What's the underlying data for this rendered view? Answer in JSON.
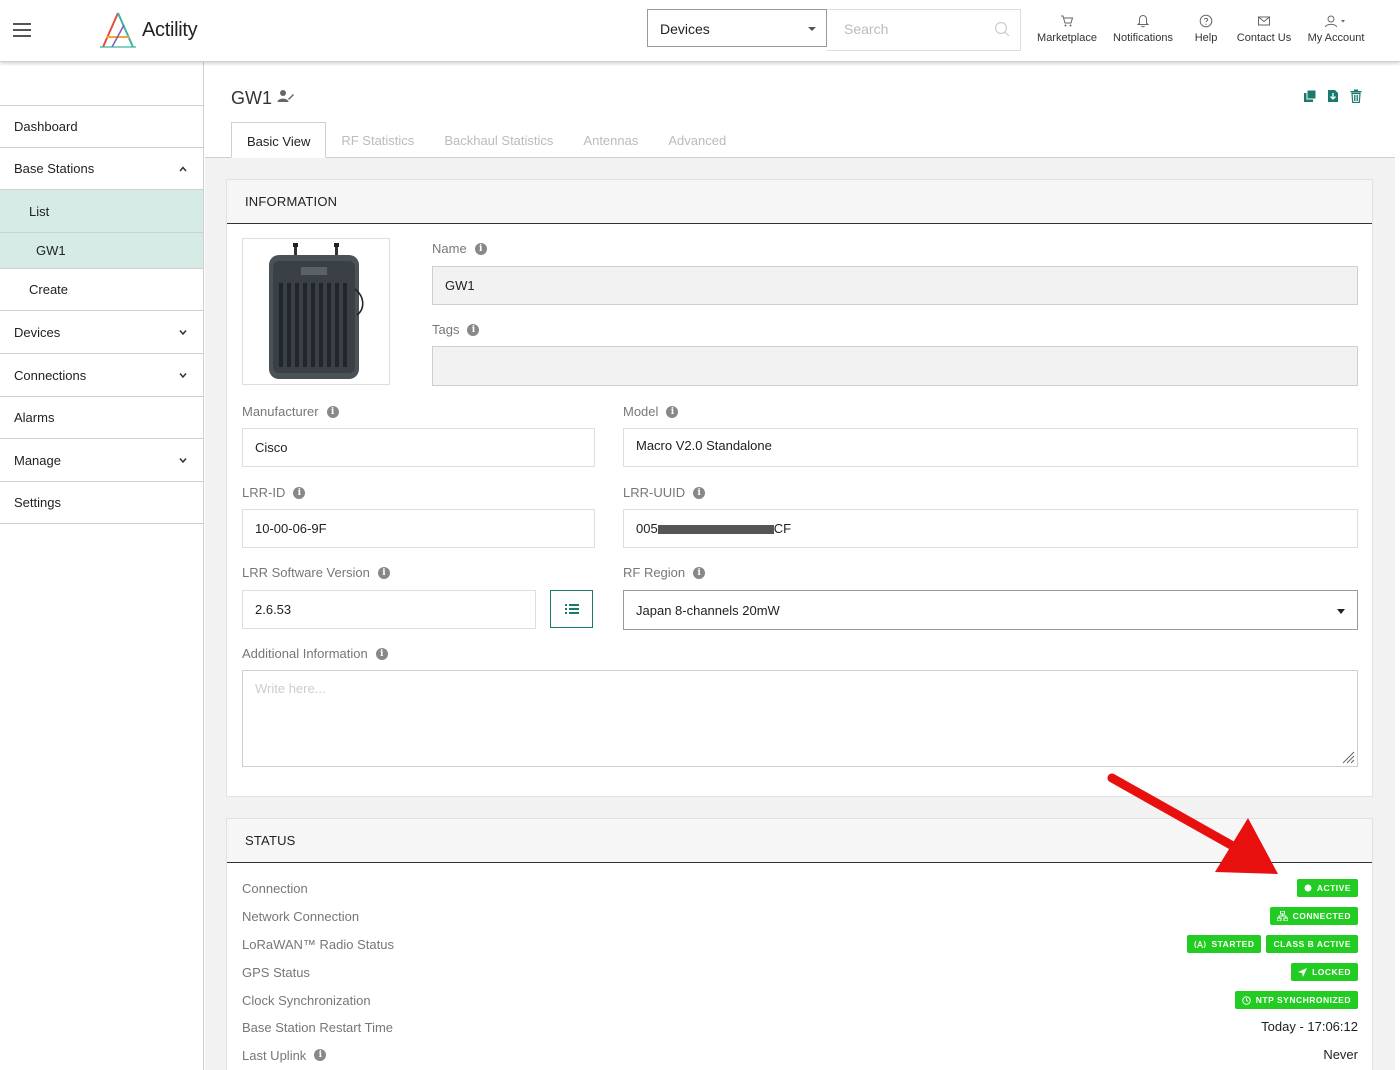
{
  "header": {
    "logo_text": "Actility",
    "entity_selector": "Devices",
    "search_placeholder": "Search",
    "nav": [
      {
        "label": "Marketplace",
        "icon": "cart-icon"
      },
      {
        "label": "Notifications",
        "icon": "bell-icon"
      },
      {
        "label": "Help",
        "icon": "help-icon"
      },
      {
        "label": "Contact Us",
        "icon": "mail-icon"
      },
      {
        "label": "My Account",
        "icon": "user-icon"
      }
    ]
  },
  "sidebar": {
    "items": [
      {
        "label": "Dashboard"
      },
      {
        "label": "Base Stations"
      },
      {
        "label": "List"
      },
      {
        "label": "GW1"
      },
      {
        "label": "Create"
      },
      {
        "label": "Devices"
      },
      {
        "label": "Connections"
      },
      {
        "label": "Alarms"
      },
      {
        "label": "Manage"
      },
      {
        "label": "Settings"
      }
    ]
  },
  "page": {
    "title": "GW1",
    "tabs": [
      "Basic View",
      "RF Statistics",
      "Backhaul Statistics",
      "Antennas",
      "Advanced"
    ]
  },
  "information": {
    "heading": "INFORMATION",
    "name_label": "Name",
    "name_value": "GW1",
    "tags_label": "Tags",
    "tags_value": "",
    "manufacturer_label": "Manufacturer",
    "manufacturer_value": "Cisco",
    "model_label": "Model",
    "model_value": "Macro V2.0 Standalone",
    "lrr_id_label": "LRR-ID",
    "lrr_id_value": "10-00-06-9F",
    "lrr_uuid_label": "LRR-UUID",
    "lrr_uuid_prefix": "005",
    "lrr_uuid_suffix": "CF",
    "software_label": "LRR Software Version",
    "software_value": "2.6.53",
    "rf_region_label": "RF Region",
    "rf_region_value": "Japan 8-channels 20mW",
    "additional_label": "Additional Information",
    "additional_placeholder": "Write here..."
  },
  "status": {
    "heading": "STATUS",
    "connection_label": "Connection",
    "connection_badge": "ACTIVE",
    "network_label": "Network Connection",
    "network_badge": "CONNECTED",
    "radio_label": "LoRaWAN™ Radio Status",
    "radio_badge_1": "STARTED",
    "radio_badge_2": "CLASS B ACTIVE",
    "gps_label": "GPS Status",
    "gps_badge": "LOCKED",
    "clock_label": "Clock Synchronization",
    "clock_badge": "NTP SYNCHRONIZED",
    "restart_label": "Base Station Restart Time",
    "restart_value": "Today - 17:06:12",
    "uplink_label": "Last Uplink",
    "uplink_value": "Never"
  },
  "colors": {
    "accent": "#1a7a6e",
    "status_green": "#22cc22",
    "sidebar_active": "#d6ebe6",
    "arrow_red": "#e8100f"
  }
}
